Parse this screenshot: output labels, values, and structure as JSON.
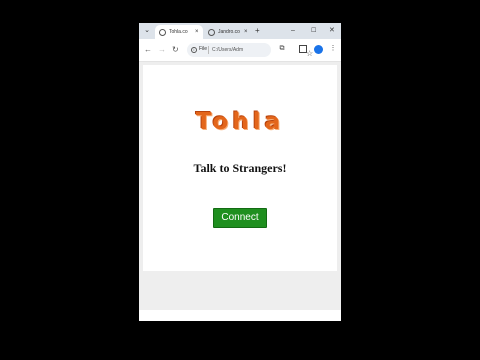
{
  "browser": {
    "tabs": [
      {
        "title": "Tohla.co",
        "close": "×"
      },
      {
        "title": "Jandro.co",
        "close": "×"
      }
    ],
    "new_tab": "+",
    "window_controls": {
      "minimize": "–",
      "maximize": "☐",
      "close": "✕"
    },
    "tab_menu": "⌄",
    "nav": {
      "back": "←",
      "forward": "→",
      "reload": "↻"
    },
    "omnibox": {
      "info": "i",
      "scheme": "File",
      "url": "C:/Users/Adm"
    },
    "icons": {
      "star": "☆",
      "extensions": "⧉",
      "side_panel": "",
      "menu": "⋮"
    }
  },
  "page": {
    "logo_text": "Tohla",
    "tagline": "Talk to Strangers!",
    "connect_label": "Connect"
  },
  "colors": {
    "logo": "#e3661b",
    "button": "#1f8f1f",
    "tabstrip": "#dde3ea"
  }
}
